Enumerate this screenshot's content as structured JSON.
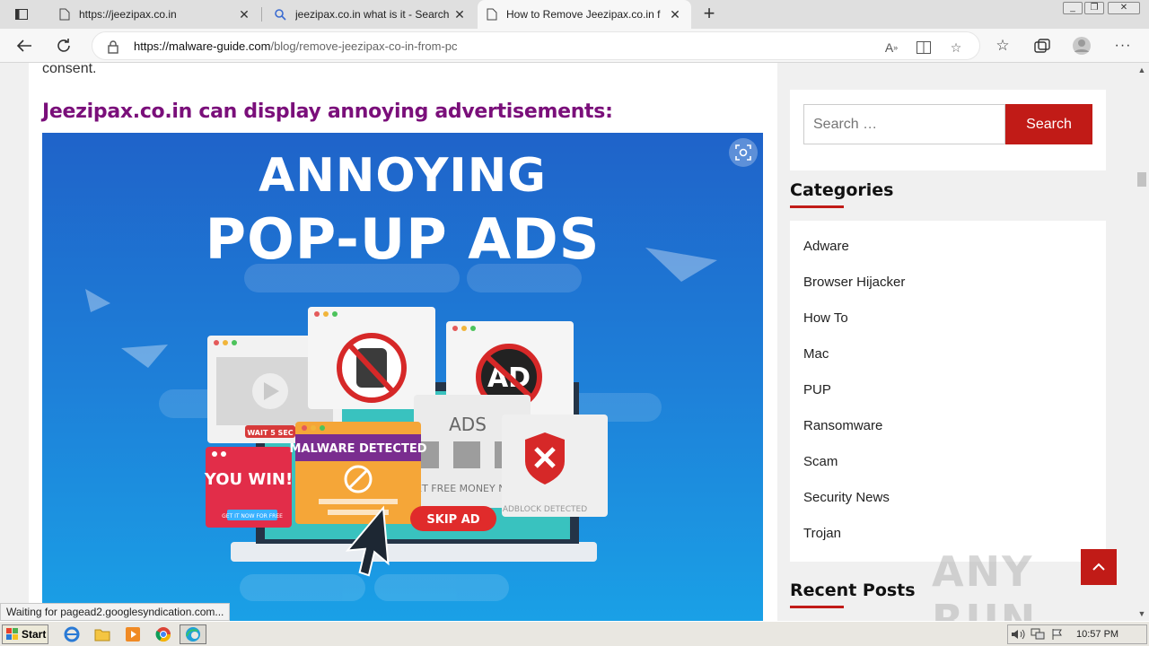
{
  "browser": {
    "tabs": [
      {
        "title": "https://jeezipax.co.in"
      },
      {
        "title": "jeezipax.co.in what is it - Search"
      },
      {
        "title": "How to Remove Jeezipax.co.in f"
      }
    ],
    "url_host": "https://malware-guide.com",
    "url_path": "/blog/remove-jeezipax-co-in-from-pc"
  },
  "article": {
    "consent_text": "consent.",
    "heading": "Jeezipax.co.in can display annoying advertisements:",
    "image": {
      "title_line1": "ANNOYING",
      "title_line2": "POP-UP ADS",
      "labels": {
        "wait": "WAIT 5 SEC",
        "malware": "MALWARE DETECTED",
        "ads": "ADS",
        "you_win": "YOU WIN!",
        "get_it_now": "GET IT NOW FOR FREE",
        "get_free_money": "GET FREE MONEY NOW!",
        "skip_ad": "SKIP AD",
        "adblock": "ADBLOCK DETECTED",
        "ad": "AD"
      }
    }
  },
  "sidebar": {
    "search_placeholder": "Search …",
    "search_button": "Search",
    "categories_title": "Categories",
    "categories": [
      "Adware",
      "Browser Hijacker",
      "How To",
      "Mac",
      "PUP",
      "Ransomware",
      "Scam",
      "Security News",
      "Trojan"
    ],
    "recent_posts_title": "Recent Posts"
  },
  "status_text": "Waiting for pagead2.googlesyndication.com...",
  "watermark": "ANY RUN",
  "taskbar": {
    "start_label": "Start",
    "clock": "10:57 PM"
  },
  "colors": {
    "accent_red": "#c11b17",
    "heading_purple": "#7a0f7a"
  }
}
